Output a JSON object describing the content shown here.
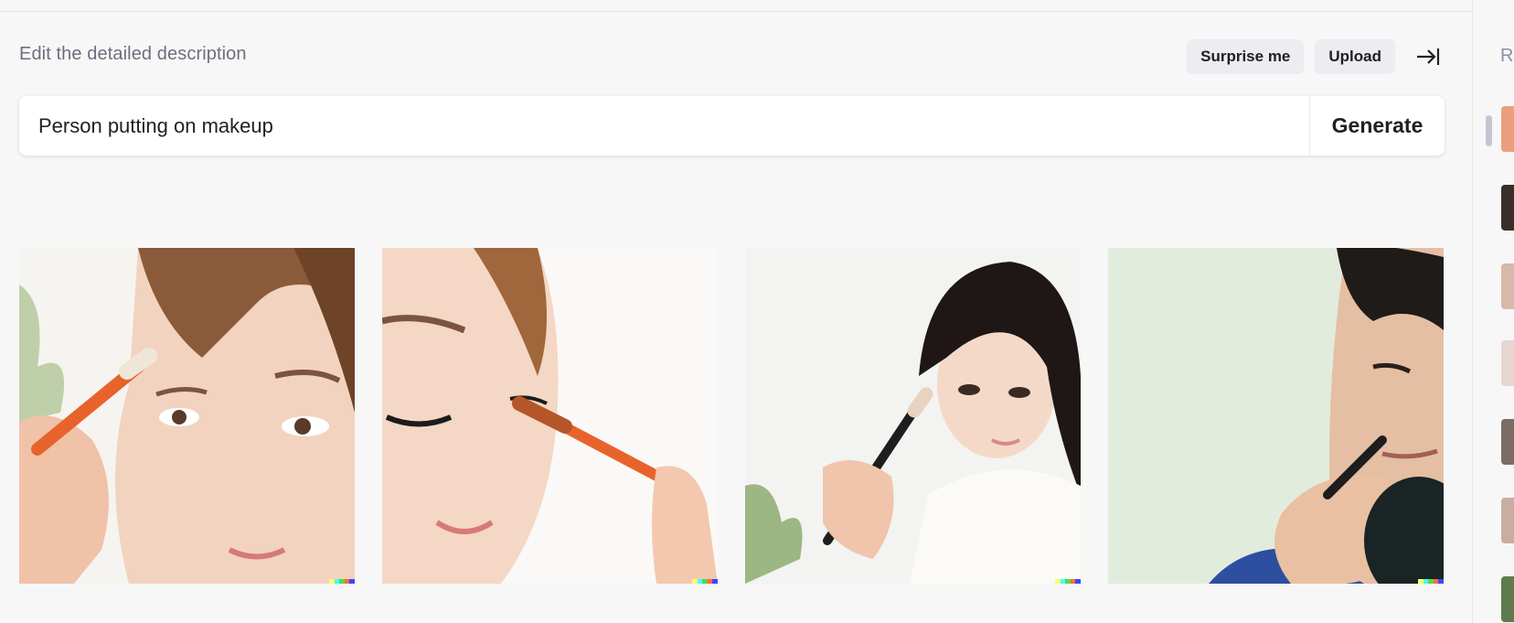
{
  "header": {
    "title": "Edit the detailed description",
    "surprise_label": "Surprise me",
    "upload_label": "Upload"
  },
  "prompt": {
    "value": "Person putting on makeup",
    "generate_label": "Generate"
  },
  "results": [
    {
      "subject": "woman-brush-eyebrow"
    },
    {
      "subject": "woman-mascara"
    },
    {
      "subject": "woman-powder-brush"
    },
    {
      "subject": "man-brush-mirror"
    }
  ],
  "signature_colors": [
    "#ffff66",
    "#42ffff",
    "#51da4c",
    "#ff6e3c",
    "#3c46ff"
  ],
  "side_panel": {
    "title": "R"
  }
}
